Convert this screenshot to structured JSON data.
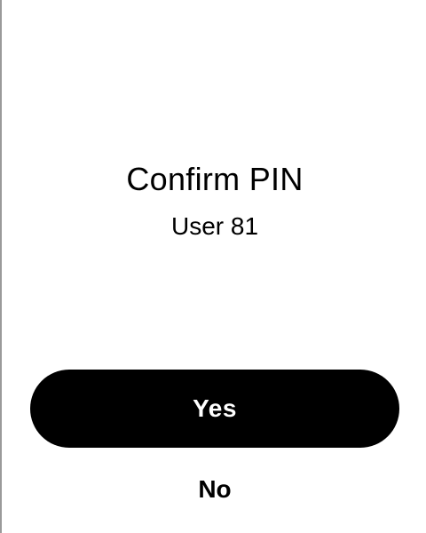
{
  "dialog": {
    "title": "Confirm PIN",
    "subtitle": "User 81"
  },
  "actions": {
    "yes_label": "Yes",
    "no_label": "No"
  },
  "colors": {
    "background": "#ffffff",
    "primary_button": "#000000",
    "primary_button_text": "#ffffff",
    "text": "#000000"
  }
}
